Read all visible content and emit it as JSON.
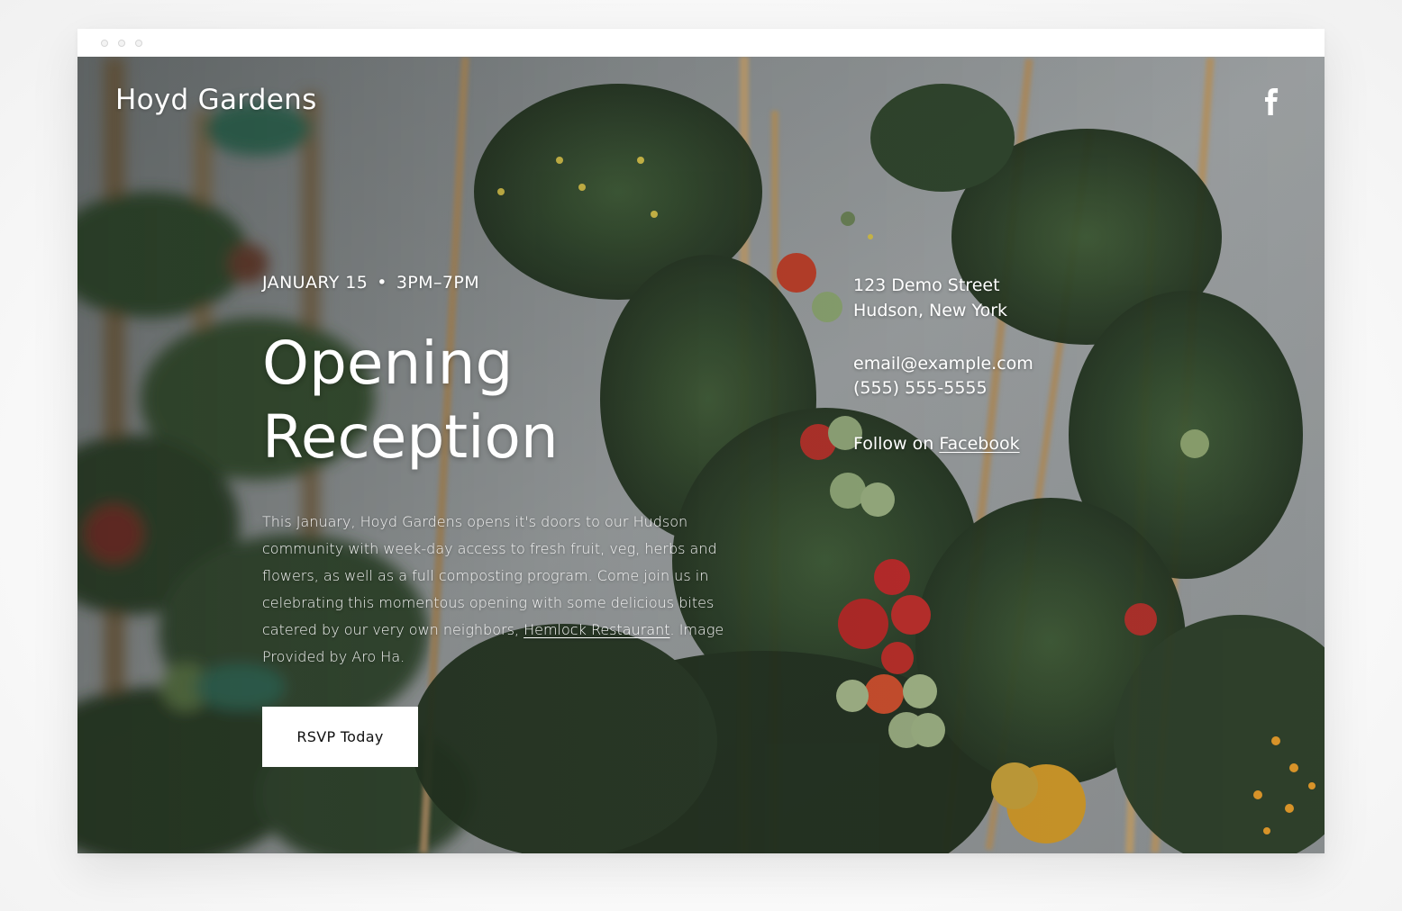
{
  "site": {
    "brand": "Hoyd Gardens",
    "social_icon": "facebook-icon"
  },
  "event": {
    "date": "JANUARY 15",
    "separator": "•",
    "time": "3PM–7PM",
    "title_line1": "Opening",
    "title_line2": "Reception",
    "description_before": "This January, Hoyd Gardens opens it's doors to our Hudson community with week-day access to fresh fruit, veg, herbs and flowers, as well as a full composting program. Come join us in celebrating this momentous opening with some delicious bites catered by our very own neighbors, ",
    "description_link": "Hemlock Restaurant",
    "description_after": ". Image Provided by Aro Ha.",
    "rsvp_label": "RSVP Today"
  },
  "contact": {
    "street": "123 Demo Street",
    "city": "Hudson, New York",
    "email": "email@example.com",
    "phone": "(555) 555-5555",
    "follow_prefix": "Follow on ",
    "follow_link": "Facebook"
  },
  "colors": {
    "text": "#ffffff",
    "button_bg": "#ffffff",
    "button_text": "#111111"
  }
}
